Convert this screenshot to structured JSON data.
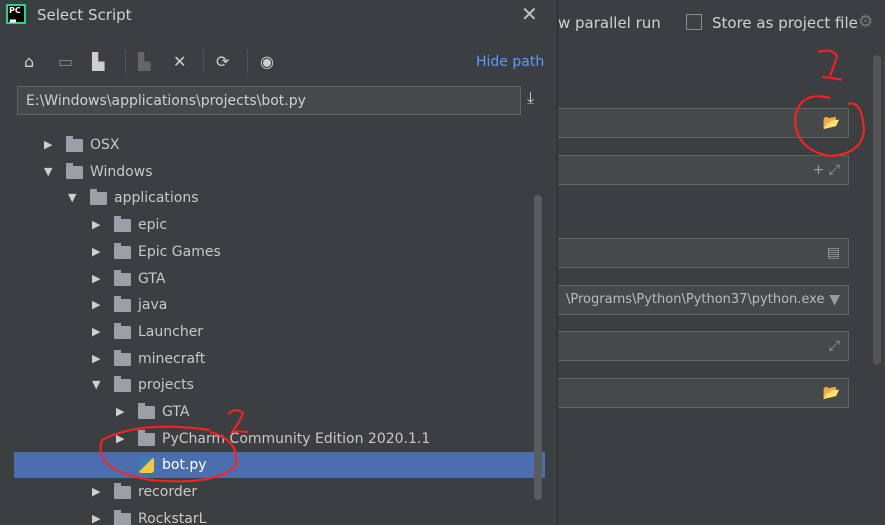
{
  "dialog": {
    "title": "Select Script",
    "hide_path": "Hide path",
    "path_value": "E:\\Windows\\applications\\projects\\bot.py"
  },
  "toolbar": {
    "icons": [
      "home-icon",
      "desktop-icon",
      "project-folder-icon",
      "new-folder-icon",
      "delete-icon",
      "refresh-icon",
      "show-hidden-icon"
    ]
  },
  "tree": [
    {
      "label": "OSX",
      "level": 0,
      "expanded": false,
      "type": "folder"
    },
    {
      "label": "Windows",
      "level": 0,
      "expanded": true,
      "type": "folder"
    },
    {
      "label": "applications",
      "level": 1,
      "expanded": true,
      "type": "folder"
    },
    {
      "label": "epic",
      "level": 2,
      "expanded": false,
      "type": "folder"
    },
    {
      "label": "Epic Games",
      "level": 2,
      "expanded": false,
      "type": "folder"
    },
    {
      "label": "GTA",
      "level": 2,
      "expanded": false,
      "type": "folder"
    },
    {
      "label": "java",
      "level": 2,
      "expanded": false,
      "type": "folder"
    },
    {
      "label": "Launcher",
      "level": 2,
      "expanded": false,
      "type": "folder"
    },
    {
      "label": "minecraft",
      "level": 2,
      "expanded": false,
      "type": "folder"
    },
    {
      "label": "projects",
      "level": 2,
      "expanded": true,
      "type": "folder"
    },
    {
      "label": "GTA",
      "level": 3,
      "expanded": false,
      "type": "folder"
    },
    {
      "label": "PyCharm Community Edition 2020.1.1",
      "level": 3,
      "expanded": false,
      "type": "folder"
    },
    {
      "label": "bot.py",
      "level": 3,
      "type": "python-file",
      "selected": true
    },
    {
      "label": "recorder",
      "level": 2,
      "expanded": false,
      "type": "folder"
    },
    {
      "label": "RockstarL",
      "level": 2,
      "expanded": false,
      "type": "folder"
    }
  ],
  "background": {
    "parallel_run": "w parallel run",
    "store_project": "Store as project file",
    "interpreter": "\\Programs\\Python\\Python37\\python.exe"
  },
  "colors": {
    "selection": "#4b6eaf",
    "link": "#589df6",
    "annotation": "#ff2020"
  }
}
